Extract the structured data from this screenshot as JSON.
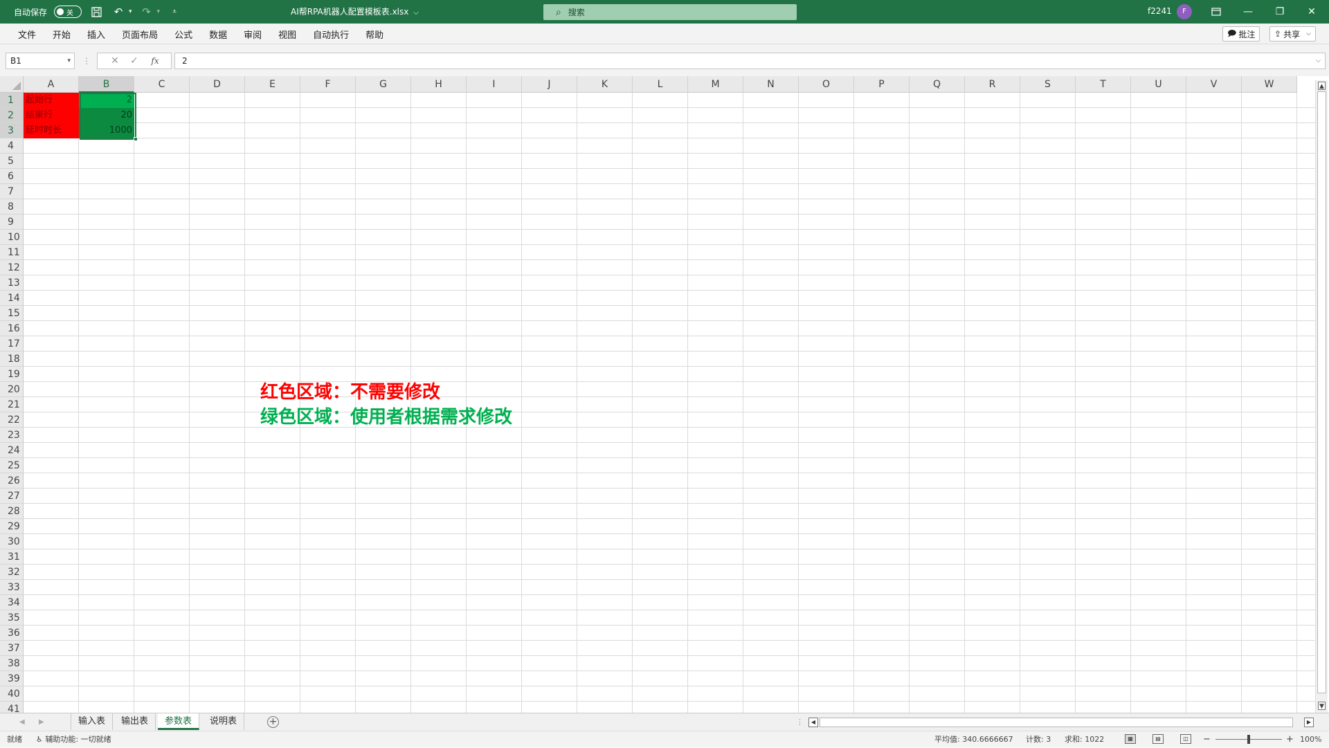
{
  "titlebar": {
    "autosave_label": "自动保存",
    "autosave_state": "关",
    "doc_title": "AI帮RPA机器人配置模板表.xlsx",
    "search_placeholder": "搜索",
    "user_name": "f2241",
    "avatar_initial": "F",
    "icons": [
      "save-icon",
      "undo-icon",
      "redo-icon",
      "customize-icon",
      "ribbon-display-icon",
      "minimize-icon",
      "restore-icon",
      "close-icon"
    ]
  },
  "menu": {
    "items": [
      "文件",
      "开始",
      "插入",
      "页面布局",
      "公式",
      "数据",
      "审阅",
      "视图",
      "自动执行",
      "帮助"
    ],
    "comment_label": "批注",
    "share_label": "共享"
  },
  "formulabar": {
    "name_box": "B1",
    "formula_value": "2",
    "fx_label": "fx"
  },
  "grid": {
    "columns": [
      "A",
      "B",
      "C",
      "D",
      "E",
      "F",
      "G",
      "H",
      "I",
      "J",
      "K",
      "L",
      "M",
      "N",
      "O",
      "P",
      "Q",
      "R",
      "S",
      "T",
      "U",
      "V",
      "W"
    ],
    "active_column": "B",
    "rows": [
      "1",
      "2",
      "3",
      "4",
      "5",
      "6",
      "7",
      "8",
      "9",
      "10",
      "11",
      "12",
      "13",
      "14",
      "15",
      "16",
      "17",
      "18",
      "19",
      "20",
      "21",
      "22",
      "23",
      "24",
      "25",
      "26",
      "27",
      "28",
      "29",
      "30",
      "31",
      "32",
      "33",
      "34",
      "35",
      "36",
      "37",
      "38",
      "39",
      "40",
      "41"
    ],
    "active_rows": [
      "1",
      "2",
      "3"
    ],
    "cells": {
      "A1": "起始行",
      "A2": "结束行",
      "A3": "延时时长",
      "B1": "2",
      "B2": "20",
      "B3": "1000"
    },
    "notes": {
      "red": "红色区域：不需要修改",
      "green": "绿色区域：使用者根据需求修改"
    },
    "colors": {
      "red_region": "#ff0000",
      "green_region": "#00b050",
      "accent": "#217346"
    }
  },
  "sheets": {
    "tabs": [
      "输入表",
      "输出表",
      "参数表",
      "说明表"
    ],
    "active": "参数表"
  },
  "status": {
    "ready": "就绪",
    "accessibility": "辅助功能: 一切就绪",
    "average": "平均值: 340.6666667",
    "count": "计数: 3",
    "sum": "求和: 1022",
    "zoom": "100%"
  }
}
